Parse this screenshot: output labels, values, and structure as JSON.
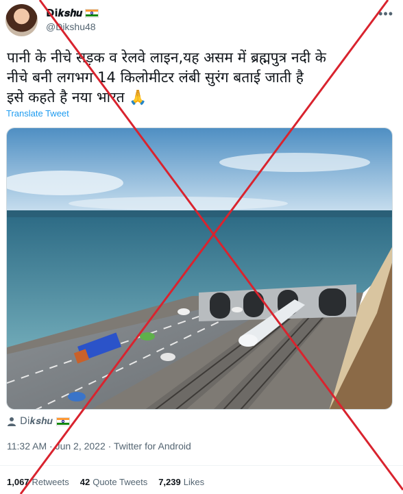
{
  "user": {
    "display_name": "Di𝒌𝒔𝒉𝒖",
    "handle": "@Dikshu48"
  },
  "tweet": {
    "lines": [
      "पानी के नीचे सड़क व रेलवे लाइन,यह असम में ब्रह्मपुत्र नदी के",
      "नीचे बनी लगभग 14 किलोमीटर लंबी सुरंग बताई जाती है",
      "इसे कहते है नया भारत 🙏"
    ],
    "translate_label": "Translate Tweet"
  },
  "attribution": {
    "name": "Di𝒌𝒔𝒉𝒖"
  },
  "meta": {
    "time": "11:32 AM",
    "date": "Jun 2, 2022",
    "source": "Twitter for Android"
  },
  "stats": [
    {
      "count": "1,067",
      "label": "Retweets"
    },
    {
      "count": "42",
      "label": "Quote Tweets"
    },
    {
      "count": "7,239",
      "label": "Likes"
    }
  ],
  "colors": {
    "accent": "#1d9bf0",
    "cross": "#d9232e",
    "secondary_text": "#536471"
  }
}
